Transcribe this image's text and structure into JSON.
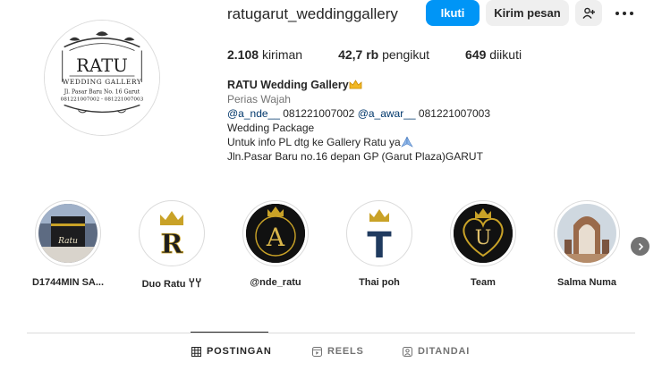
{
  "profile": {
    "username": "ratugarut_weddinggallery",
    "logo_text": {
      "brand": "RATU",
      "tagline": "WEDDING GALLERY",
      "address": "Jl. Pasar Baru No. 16 Garut",
      "phones": "081221007002 - 081221007003"
    }
  },
  "actions": {
    "follow": "Ikuti",
    "message": "Kirim pesan",
    "suggest_icon": "person-add-icon",
    "more_icon": "more-horizontal-icon"
  },
  "stats": [
    {
      "value": "2.108",
      "label": "kiriman"
    },
    {
      "value": "42,7 rb",
      "label": "pengikut"
    },
    {
      "value": "649",
      "label": "diikuti"
    }
  ],
  "bio": {
    "name": "RATU Wedding Gallery",
    "category": "Perias Wajah",
    "mention1": "@a_nde__",
    "phone1": "081221007002",
    "mention2": "@a_awar__",
    "phone2": "081221007003",
    "line3": "Wedding Package",
    "line4": "Untuk info PL dtg ke Gallery Ratu ya",
    "line5": "Jln.Pasar Baru no.16 depan GP (Garut Plaza)GARUT"
  },
  "highlights": [
    {
      "label": "D1744MIN SA..."
    },
    {
      "label": "Duo Ratu 𐩠𐩠"
    },
    {
      "label": "@nde_ratu",
      "letter": "A"
    },
    {
      "label": "Thai poh",
      "letter": "T"
    },
    {
      "label": "Team",
      "letter": "U"
    },
    {
      "label": "Salma Numa"
    }
  ],
  "highlight_misc": {
    "avatar_letter": "R",
    "avatar_text": "Ratu"
  },
  "tabs": [
    {
      "label": "POSTINGAN",
      "icon": "grid-icon",
      "active": true
    },
    {
      "label": "REELS",
      "icon": "reels-icon",
      "active": false
    },
    {
      "label": "DITANDAI",
      "icon": "tagged-icon",
      "active": false
    }
  ],
  "colors": {
    "accent": "#0095f6",
    "gold": "#c9a227",
    "muted": "#737373",
    "link": "#00376b"
  }
}
